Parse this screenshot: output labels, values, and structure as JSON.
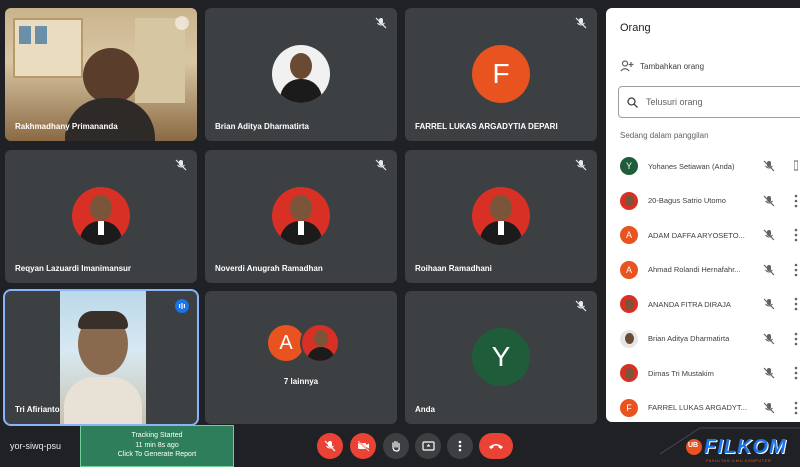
{
  "tiles": [
    {
      "name": "Rakhmadhany Primananda",
      "kind": "video"
    },
    {
      "name": "Brian Aditya Dharmatirta",
      "kind": "photo"
    },
    {
      "name": "FARREL LUKAS ARGADYTIA DEPARI",
      "kind": "letter",
      "letter": "F",
      "color": "#e8531f"
    },
    {
      "name": "Reqyan Lazuardi Imanimansur",
      "kind": "photo"
    },
    {
      "name": "Noverdi Anugrah Ramadhan",
      "kind": "photo"
    },
    {
      "name": "Roihaan Ramadhani",
      "kind": "photo"
    },
    {
      "name": "Tri Afirianto",
      "kind": "video"
    },
    {
      "name": "7 lainnya",
      "kind": "group",
      "letter": "A",
      "color": "#e8531f"
    },
    {
      "name": "Anda",
      "kind": "letter",
      "letter": "Y",
      "color": "#1e5c3a"
    }
  ],
  "panel": {
    "title": "Orang",
    "add_label": "Tambahkan orang",
    "search_placeholder": "Telusuri orang",
    "section_label": "Sedang dalam panggilan",
    "participants": [
      {
        "name": "Yohanes Setiawan (Anda)",
        "avatar": "letter",
        "letter": "Y",
        "color": "#1e5c3a"
      },
      {
        "name": "20-Bagus Satrio Utomo",
        "avatar": "photo"
      },
      {
        "name": "ADAM DAFFA ARYOSETO...",
        "avatar": "letter",
        "letter": "A",
        "color": "#e8531f"
      },
      {
        "name": "Ahmad Rolandi Hernafahr...",
        "avatar": "letter",
        "letter": "A",
        "color": "#e8531f"
      },
      {
        "name": "ANANDA FITRA DIRAJA",
        "avatar": "photo"
      },
      {
        "name": "Brian Aditya Dharmatirta",
        "avatar": "photo"
      },
      {
        "name": "Dimas Tri Mustakim",
        "avatar": "photo"
      },
      {
        "name": "FARREL LUKAS ARGADYT...",
        "avatar": "letter",
        "letter": "F",
        "color": "#e8531f"
      }
    ]
  },
  "bottom": {
    "meeting_code": "yor-siwq-psu",
    "tracking": {
      "line1": "Tracking Started",
      "line2": "11 min 8s ago",
      "line3": "Click To Generate Report"
    }
  },
  "logo": {
    "badge": "UB",
    "text": "FILKOM",
    "subtitle": "FAKULTAS ILMU KOMPUTER"
  }
}
